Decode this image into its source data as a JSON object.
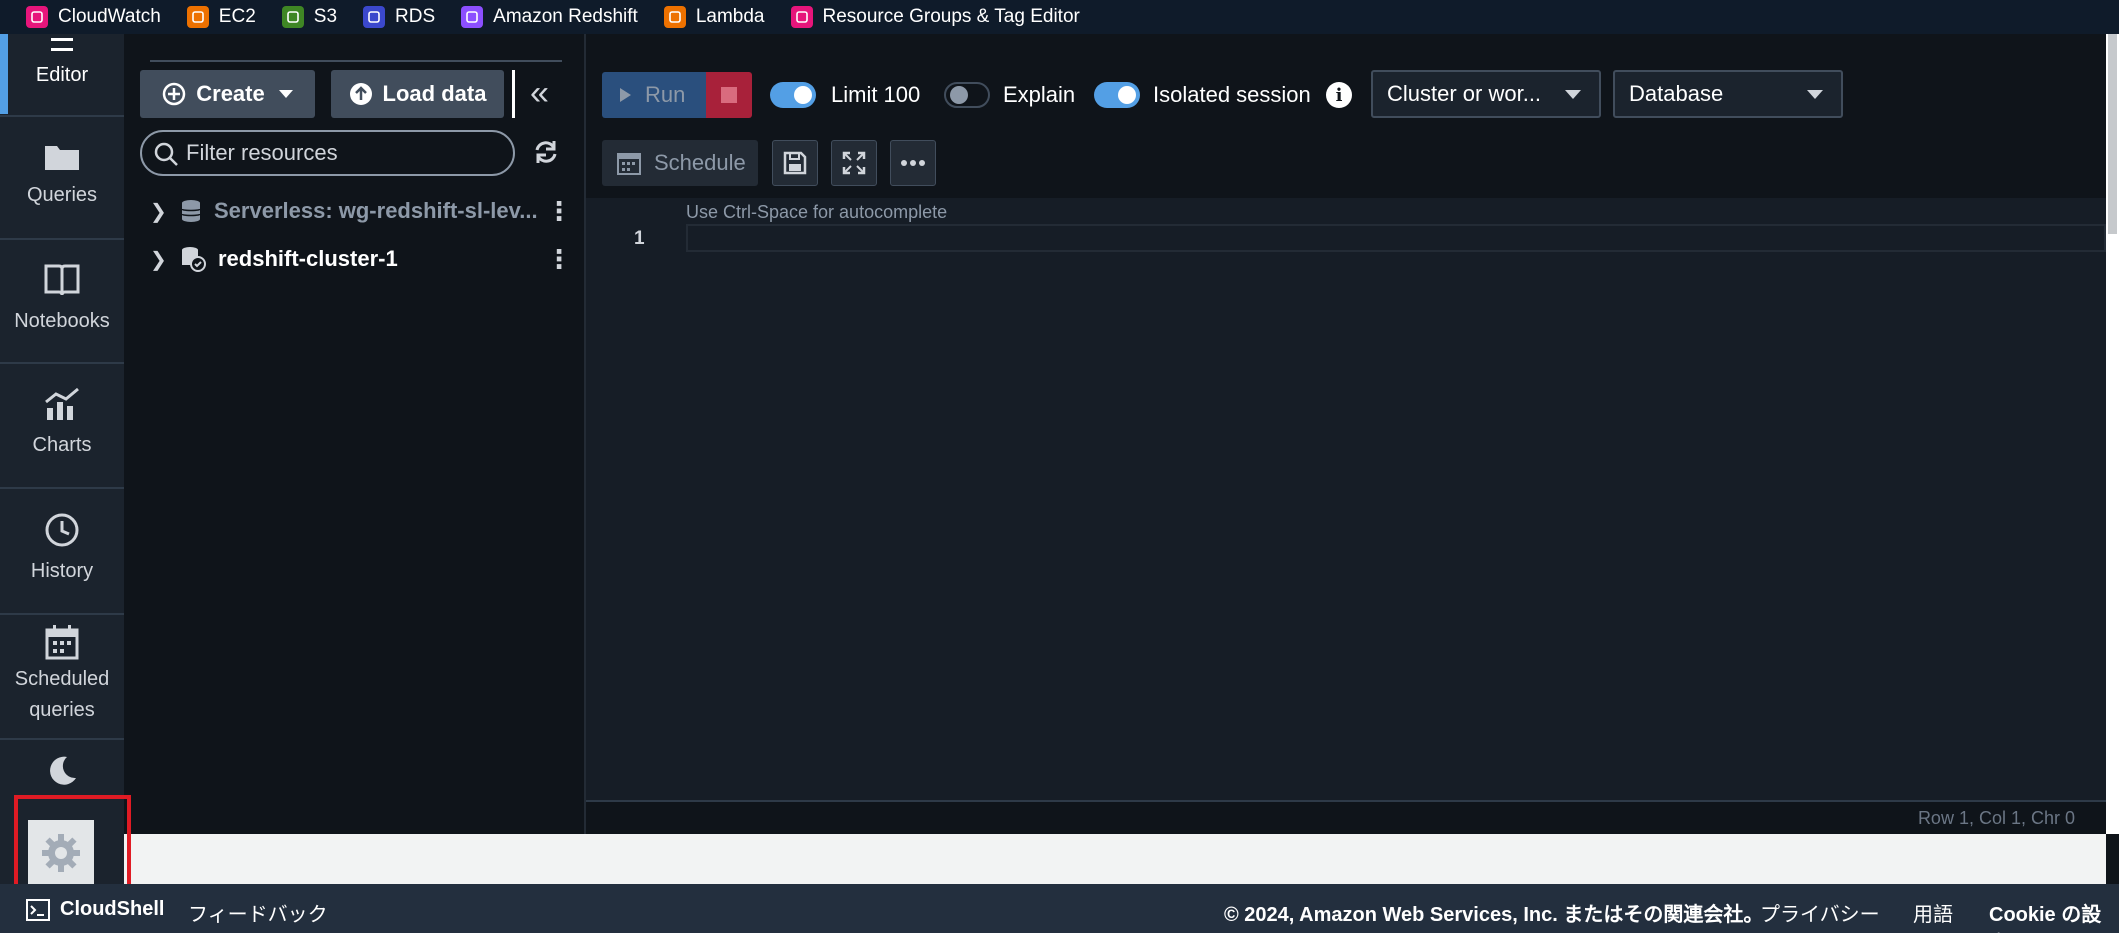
{
  "favorites": [
    {
      "label": "CloudWatch",
      "color": "#e7157b",
      "icon": "cloudwatch-icon"
    },
    {
      "label": "EC2",
      "color": "#ed7100",
      "icon": "ec2-icon"
    },
    {
      "label": "S3",
      "color": "#3f8624",
      "icon": "s3-icon"
    },
    {
      "label": "RDS",
      "color": "#3b48cc",
      "icon": "rds-icon"
    },
    {
      "label": "Amazon Redshift",
      "color": "#8c4fff",
      "icon": "redshift-icon"
    },
    {
      "label": "Lambda",
      "color": "#ed7100",
      "icon": "lambda-icon"
    },
    {
      "label": "Resource Groups & Tag Editor",
      "color": "#e7157b",
      "icon": "resource-groups-icon"
    }
  ],
  "rail": {
    "editor": "Editor",
    "queries": "Queries",
    "notebooks": "Notebooks",
    "charts": "Charts",
    "history": "History",
    "scheduled_line1": "Scheduled",
    "scheduled_line2": "queries"
  },
  "resources": {
    "create_label": "Create",
    "load_label": "Load data",
    "filter_placeholder": "Filter resources",
    "items": [
      {
        "label": "Serverless: wg-redshift-sl-lev..."
      },
      {
        "label": "redshift-cluster-1"
      }
    ]
  },
  "toolbar": {
    "run_label": "Run",
    "limit_label": "Limit 100",
    "explain_label": "Explain",
    "isolated_label": "Isolated session",
    "info_glyph": "i",
    "cluster_select": "Cluster or wor...",
    "database_select": "Database",
    "schedule_label": "Schedule"
  },
  "editor": {
    "hint": "Use Ctrl-Space for autocomplete",
    "line_number": "1",
    "status": "Row 1,  Col 1,  Chr 0"
  },
  "footer": {
    "cloudshell": "CloudShell",
    "feedback": "フィードバック",
    "copyright": "© 2024, Amazon Web Services, Inc. またはその関連会社。",
    "privacy": "プライバシー",
    "terms": "用語",
    "cookie": "Cookie の設定"
  },
  "colors": {
    "accent": "#539fe5",
    "highlight_box": "#e01b24",
    "stop": "#a8213a"
  }
}
